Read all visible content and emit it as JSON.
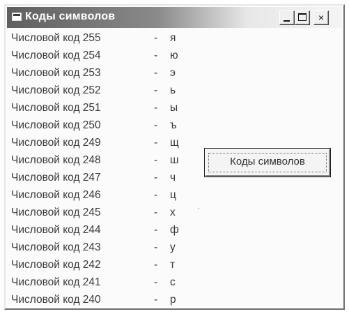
{
  "window": {
    "title": "Коды символов",
    "controls": {
      "minimize": "_",
      "maximize": "□",
      "close": "×"
    }
  },
  "list": {
    "rows": [
      {
        "label": "Числовой код 255",
        "dash": "-",
        "char": "я"
      },
      {
        "label": "Числовой код 254",
        "dash": "-",
        "char": "ю"
      },
      {
        "label": "Числовой код 253",
        "dash": "-",
        "char": "э"
      },
      {
        "label": "Числовой код 252",
        "dash": "-",
        "char": "ь"
      },
      {
        "label": "Числовой код 251",
        "dash": "-",
        "char": "ы"
      },
      {
        "label": "Числовой код 250",
        "dash": "-",
        "char": "ъ"
      },
      {
        "label": "Числовой код 249",
        "dash": "-",
        "char": "щ"
      },
      {
        "label": "Числовой код 248",
        "dash": "-",
        "char": "ш"
      },
      {
        "label": "Числовой код 247",
        "dash": "-",
        "char": "ч"
      },
      {
        "label": "Числовой код 246",
        "dash": "-",
        "char": "ц"
      },
      {
        "label": "Числовой код 245",
        "dash": "-",
        "char": "х"
      },
      {
        "label": "Числовой код 244",
        "dash": "-",
        "char": "ф"
      },
      {
        "label": "Числовой код 243",
        "dash": "-",
        "char": "у"
      },
      {
        "label": "Числовой код 242",
        "dash": "-",
        "char": "т"
      },
      {
        "label": "Числовой код 241",
        "dash": "-",
        "char": "с"
      },
      {
        "label": "Числовой код 240",
        "dash": "-",
        "char": "р"
      }
    ]
  },
  "action_button": {
    "label": "Коды символов"
  }
}
